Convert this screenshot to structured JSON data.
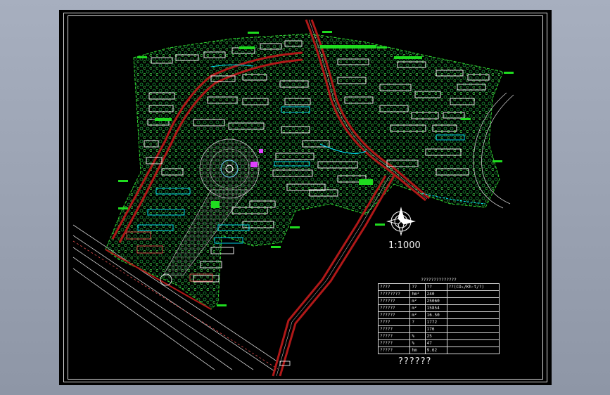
{
  "drawing": {
    "scale_label": "1:1000",
    "title_text": "??????",
    "road_label": "—————",
    "table": {
      "caption": "??????????????",
      "header": [
        "????",
        "??",
        "??",
        "??(CO₂/Kh·t/?)"
      ],
      "rows": [
        [
          "????????",
          "hm²",
          "240",
          ""
        ],
        [
          "??????",
          "m²",
          "25060",
          ""
        ],
        [
          "??????",
          "m²",
          "15854",
          ""
        ],
        [
          "??????",
          "m²",
          "16.50",
          ""
        ],
        [
          "????",
          "?",
          "1772",
          ""
        ],
        [
          "?????",
          "",
          "176",
          ""
        ],
        [
          "?????",
          "%",
          "25",
          ""
        ],
        [
          "?????",
          "%",
          "47",
          ""
        ],
        [
          "?????",
          "hm",
          "9.62",
          ""
        ]
      ]
    }
  },
  "colors": {
    "background": "#000000",
    "road": "#b01818",
    "building": "#ffffff",
    "green": "#1fdc1f",
    "cyan": "#00e5ff",
    "yellow": "#e8e800",
    "magenta": "#e040ff",
    "frame": "#dddddd"
  }
}
